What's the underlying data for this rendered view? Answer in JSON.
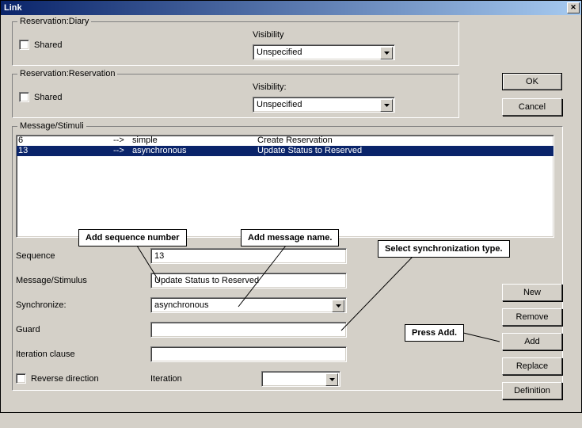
{
  "window": {
    "title": "Link"
  },
  "reservation1": {
    "legend": "Reservation:Diary",
    "shared_label": "Shared",
    "visibility_label": "Visibility",
    "visibility_value": "Unspecified"
  },
  "reservation2": {
    "legend": "Reservation:Reservation",
    "shared_label": "Shared",
    "visibility_label": "Visibility:",
    "visibility_value": "Unspecified"
  },
  "buttons": {
    "ok": "OK",
    "cancel": "Cancel",
    "new": "New",
    "remove": "Remove",
    "add": "Add",
    "replace": "Replace",
    "definition": "Definition"
  },
  "message_group": {
    "legend": "Message/Stimuli",
    "rows": [
      {
        "seq": "6",
        "arrow": "-->",
        "sync": "simple",
        "msg": "Create Reservation"
      },
      {
        "seq": "13",
        "arrow": "-->",
        "sync": "asynchronous",
        "msg": "Update Status to Reserved"
      }
    ]
  },
  "callouts": {
    "seq": "Add sequence number",
    "msg": "Add message name.",
    "sync": "Select synchronization type.",
    "add": "Press Add."
  },
  "form": {
    "sequence_label": "Sequence",
    "sequence_value": "13",
    "message_label": "Message/Stimulus",
    "message_value": "Update Status to Reserved",
    "sync_label": "Synchronize:",
    "sync_value": "asynchronous",
    "guard_label": "Guard",
    "guard_value": "",
    "iterclause_label": "Iteration clause",
    "iterclause_value": "",
    "reverse_label": "Reverse direction",
    "iteration_label": "Iteration",
    "iteration_value": ""
  }
}
